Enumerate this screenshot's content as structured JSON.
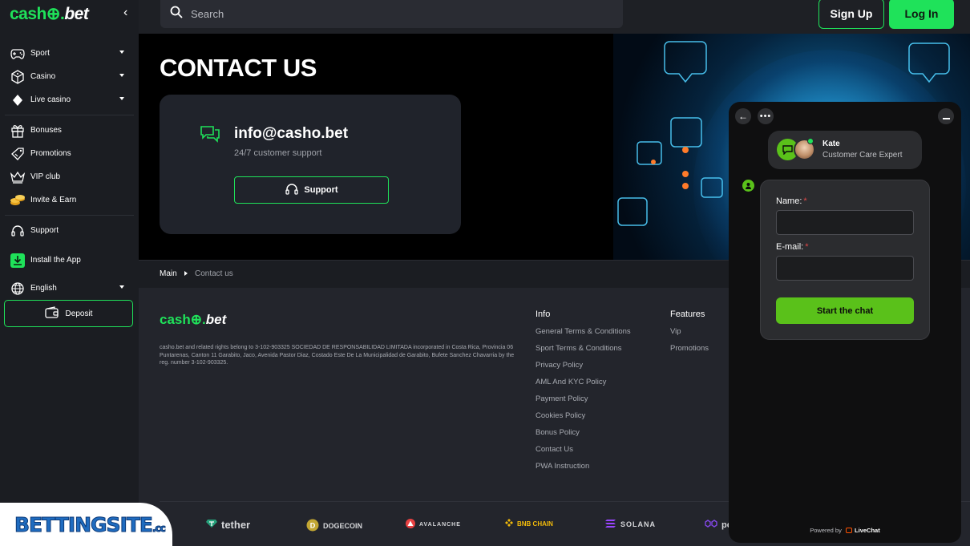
{
  "brand": {
    "part1": "cash",
    "part2": "bet"
  },
  "sidebar": {
    "items": [
      {
        "label": "Sport",
        "icon": "gamepad-icon",
        "dropdown": true
      },
      {
        "label": "Casino",
        "icon": "dice-icon",
        "dropdown": true
      },
      {
        "label": "Live casino",
        "icon": "diamond-icon",
        "dropdown": true
      },
      {
        "label": "Bonuses",
        "icon": "gift-icon"
      },
      {
        "label": "Promotions",
        "icon": "tag-icon"
      },
      {
        "label": "VIP club",
        "icon": "crown-icon"
      },
      {
        "label": "Invite & Earn",
        "icon": "coins-icon"
      },
      {
        "label": "Support",
        "icon": "headset-icon"
      },
      {
        "label": "Install the App",
        "icon": "download-icon"
      },
      {
        "label": "English",
        "icon": "globe-icon",
        "dropdown": true
      }
    ],
    "deposit_label": "Deposit"
  },
  "topbar": {
    "search_placeholder": "Search",
    "signup_label": "Sign Up",
    "login_label": "Log In"
  },
  "hero": {
    "title": "CONTACT US",
    "email": "info@casho.bet",
    "subtitle": "24/7 customer support",
    "support_label": "Support"
  },
  "breadcrumb": {
    "main": "Main",
    "current": "Contact us"
  },
  "footer": {
    "legal": "casho.bet and related rights belong to 3-102-903325 SOCIEDAD DE RESPONSABILIDAD LIMITADA incorporated in Costa Rica, Provincia 06 Puntarenas, Canton 11 Garabito, Jaco, Avenida Pastor Diaz, Costado Este De La Municipalidad de Garabito, Bufete Sanchez Chavarria by the reg. number 3-102-903325.",
    "info_title": "Info",
    "info_links": [
      "General Terms & Conditions",
      "Sport Terms & Conditions",
      "Privacy Policy",
      "AML And KYC Policy",
      "Payment Policy",
      "Cookies Policy",
      "Bonus Policy",
      "Contact Us",
      "PWA Instruction"
    ],
    "features_title": "Features",
    "features_links": [
      "Vip",
      "Promotions"
    ],
    "coins": [
      "tether",
      "DOGECOIN",
      "AVALANCHE",
      "BNB CHAIN",
      "SOLANA",
      "po"
    ]
  },
  "badge": {
    "text": "BETTINGSITE",
    "suffix": ".cc"
  },
  "chat": {
    "agent_name": "Kate",
    "agent_role": "Customer Care Expert",
    "name_label": "Name:",
    "email_label": "E-mail:",
    "required_mark": "*",
    "start_label": "Start the chat",
    "powered_prefix": "Powered by",
    "powered_brand": "LiveChat"
  },
  "colors": {
    "accent": "#1fe25a",
    "chat_green": "#5ac11a"
  }
}
